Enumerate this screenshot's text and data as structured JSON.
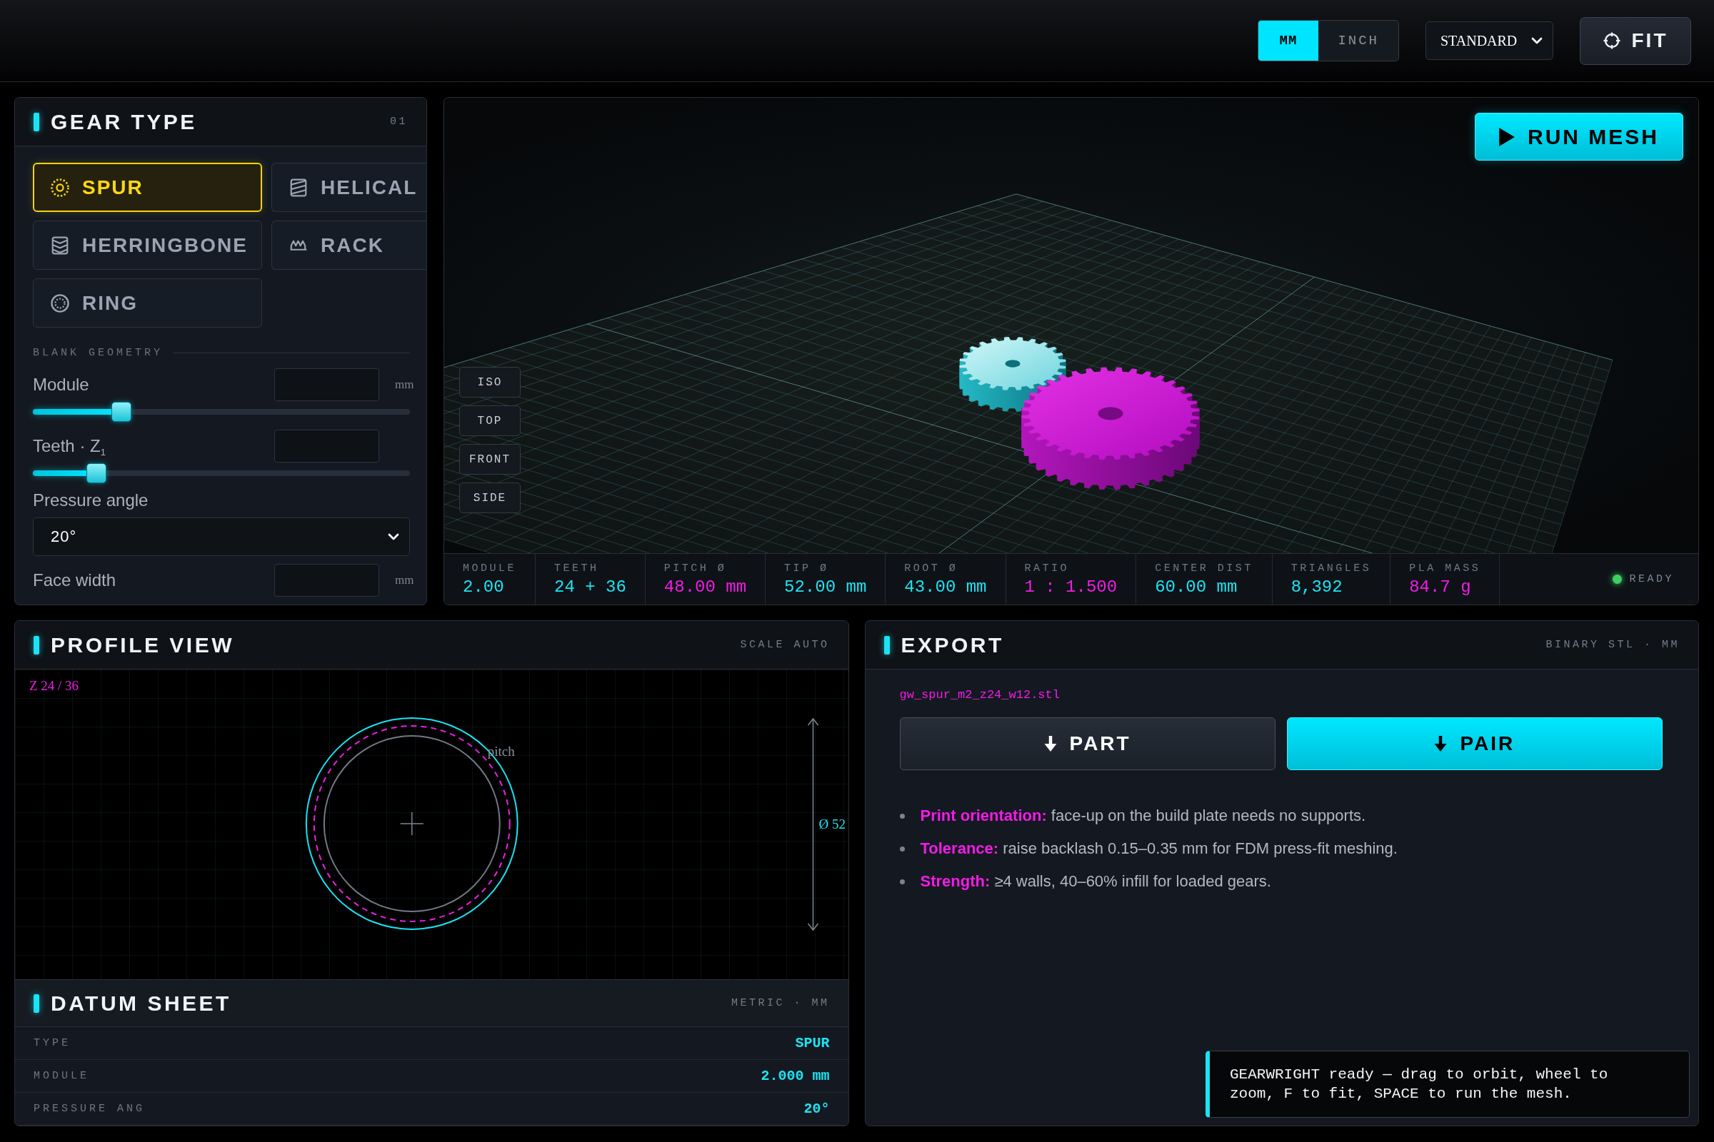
{
  "top_bar": {
    "unit_toggle": [
      {
        "label": "MM",
        "selected": true
      },
      {
        "label": "INCH",
        "selected": false
      }
    ],
    "mode_select": {
      "value": "STANDARD"
    },
    "fit_button": {
      "label": "FIT"
    }
  },
  "gear_type_panel": {
    "title": "GEAR TYPE",
    "index": "01",
    "types": [
      {
        "label": "SPUR",
        "kind": "spur",
        "selected": true
      },
      {
        "label": "HELICAL",
        "kind": "helical",
        "selected": false
      },
      {
        "label": "HERRINGBONE",
        "kind": "herringbone",
        "selected": false
      },
      {
        "label": "RACK",
        "kind": "rack",
        "selected": false
      },
      {
        "label": "RING",
        "kind": "ring",
        "selected": false
      }
    ],
    "section_label": "BLANK GEOMETRY",
    "params": [
      {
        "kind": "slider",
        "label": "Module",
        "unit": "mm",
        "level": 0.22
      },
      {
        "kind": "slider",
        "label": "Teeth · Z$_{1}$",
        "level": 0.15
      },
      {
        "kind": "select",
        "label": "Pressure angle",
        "value": "20°"
      },
      {
        "kind": "input",
        "label": "Face width",
        "unit": "mm"
      }
    ]
  },
  "viewport": {
    "run_button": {
      "label": "RUN MESH"
    },
    "view_buttons": [
      "ISO",
      "TOP",
      "FRONT",
      "SIDE"
    ],
    "stats": [
      {
        "label": "MODULE",
        "value": "2.00",
        "color": "#1fe3f2"
      },
      {
        "label": "TEETH",
        "value": "24 + 36",
        "color": "#1fe3f2"
      },
      {
        "label": "PITCH Ø",
        "value": "48.00 mm",
        "color": "#f21ce6"
      },
      {
        "label": "TIP Ø",
        "value": "52.00 mm",
        "color": "#1fe3f2"
      },
      {
        "label": "ROOT Ø",
        "value": "43.00 mm",
        "color": "#1fe3f2"
      },
      {
        "label": "RATIO",
        "value": "1 : 1.500",
        "color": "#f21ce6"
      },
      {
        "label": "CENTER DIST",
        "value": "60.00 mm",
        "color": "#1fe3f2"
      },
      {
        "label": "TRIANGLES",
        "value": "8,392",
        "color": "#1fe3f2"
      },
      {
        "label": "PLA MASS",
        "value": "84.7 g",
        "color": "#f21ce6"
      }
    ],
    "status": {
      "label": "READY",
      "color": "#3ecf63"
    }
  },
  "profile_view": {
    "title": "PROFILE VIEW",
    "scale": "SCALE AUTO",
    "teeth_label": "Z 24 / 36",
    "pitch_label": "pitch",
    "diameter_label": "Ø 52"
  },
  "datum_sheet": {
    "title": "DATUM SHEET",
    "units": "METRIC · MM",
    "rows": [
      {
        "label": "TYPE",
        "value": "SPUR"
      },
      {
        "label": "MODULE",
        "value": "2.000 mm"
      },
      {
        "label": "PRESSURE ANG",
        "value": "20°"
      }
    ]
  },
  "export": {
    "title": "EXPORT",
    "format": "BINARY STL · MM",
    "filename": "gw_spur_m2_z24_w12.stl",
    "buttons": [
      {
        "label": "PART",
        "kind": "secondary"
      },
      {
        "label": "PAIR",
        "kind": "primary"
      }
    ],
    "tips": [
      "**Print orientation:** face-up on the build plate needs no supports.",
      "**Tolerance:** raise backlash 0.15–0.35 mm for FDM press-fit meshing.",
      "**Strength:** ≥4 walls, 40–60% infill for loaded gears."
    ]
  },
  "toast": {
    "message": "GEARWRIGHT ready — drag to orbit, wheel to zoom, F to fit, SPACE to run the mesh."
  }
}
